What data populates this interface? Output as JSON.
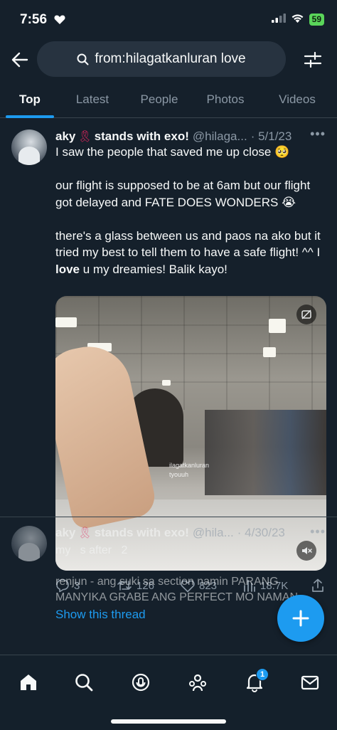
{
  "status_bar": {
    "time": "7:56",
    "battery": "59"
  },
  "search": {
    "query": "from:hilagatkanluran love"
  },
  "tabs": [
    {
      "label": "Top"
    },
    {
      "label": "Latest"
    },
    {
      "label": "People"
    },
    {
      "label": "Photos"
    },
    {
      "label": "Videos"
    }
  ],
  "tweet1": {
    "display_name_prefix": "aky",
    "display_name_suffix": "stands with exo!",
    "handle": "@hilaga...",
    "date": "· 5/1/23",
    "text_before": "I saw the people that saved me up close 🥺\n\nour flight is supposed to be at 6am but our flight got delayed and FATE DOES WONDERS 😭\n\nthere's a glass between us and paos na ako but it tried my best to tell them to have a safe flight! ^^ I ",
    "text_bold": "love",
    "text_after": " u my dreamies! Balik kayo!",
    "media_watermark_line1": "ilagatkanluran",
    "media_watermark_line2": "tyouuh",
    "replies": "3",
    "retweets": "126",
    "likes": "823",
    "views": "18.7K",
    "show_thread": "Show this thread"
  },
  "tweet2": {
    "display_name_prefix": "aky",
    "display_name_suffix": "stands with exo!",
    "handle": "@hila...",
    "date": "· 4/30/23",
    "text": "my   s after   2\n\nrenjun - ang suki sa section namin PARANG MANYIKA GRABE ANG PERFECT MO NAMAN"
  },
  "nav": {
    "notification_count": "1"
  },
  "colors": {
    "accent": "#1d9bf0",
    "background": "#15202b",
    "secondary_text": "#8b98a5"
  }
}
